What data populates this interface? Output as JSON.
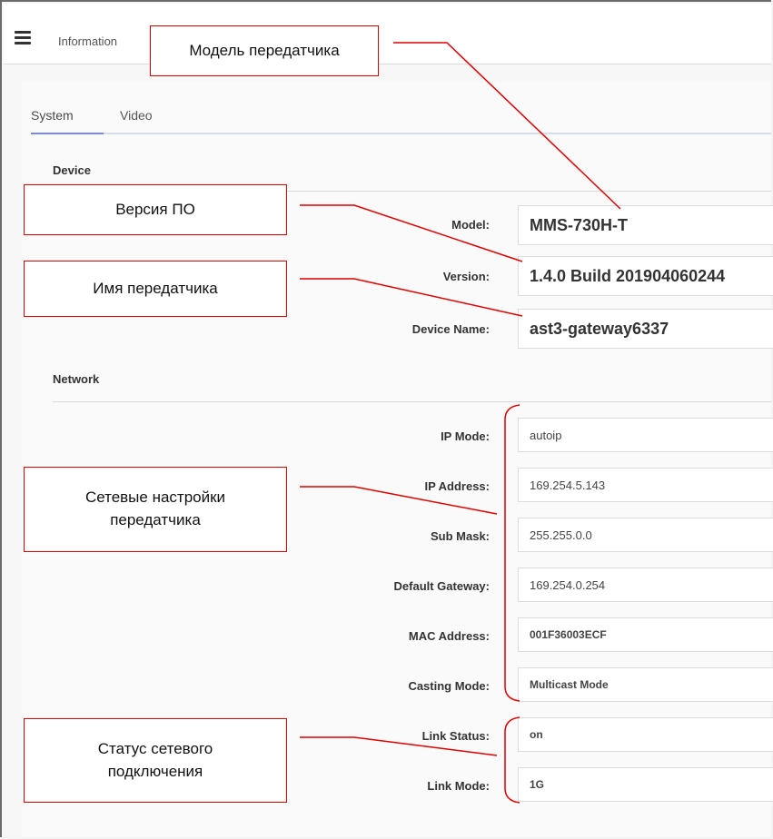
{
  "header": {
    "title": "Information",
    "menu_icon": "hamburger-icon"
  },
  "tabs": [
    {
      "label": "System"
    },
    {
      "label": "Video"
    }
  ],
  "device": {
    "section_title": "Device",
    "model_label": "Model:",
    "model_value": "MMS-730H-T",
    "version_label": "Version:",
    "version_value": "1.4.0 Build 201904060244",
    "name_label": "Device Name:",
    "name_value": "ast3-gateway6337"
  },
  "network": {
    "section_title": "Network",
    "fields": [
      {
        "label": "IP Mode:",
        "value": "autoip"
      },
      {
        "label": "IP Address:",
        "value": "169.254.5.143"
      },
      {
        "label": "Sub Mask:",
        "value": "255.255.0.0"
      },
      {
        "label": "Default Gateway:",
        "value": "169.254.0.254"
      },
      {
        "label": "MAC Address:",
        "value": "001F36003ECF"
      },
      {
        "label": "Casting Mode:",
        "value": "Multicast Mode"
      },
      {
        "label": "Link Status:",
        "value": "on"
      },
      {
        "label": "Link Mode:",
        "value": "1G"
      }
    ]
  },
  "callouts": {
    "model": "Модель передатчика",
    "version": "Версия ПО",
    "name": "Имя передатчика",
    "network": [
      "Сетевые настройки",
      "передатчика"
    ],
    "link": [
      "Статус сетевого",
      "подключения"
    ]
  },
  "colors": {
    "annotation": "#e00000",
    "tab_accent": "#7b8bd1"
  }
}
